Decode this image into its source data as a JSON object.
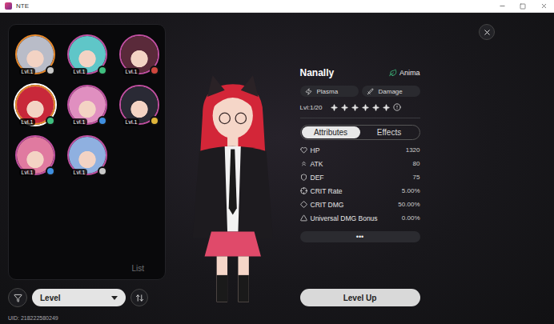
{
  "window": {
    "title": "NTE"
  },
  "characters": [
    {
      "level": "Lvl.1",
      "ring_color": "#e8892b",
      "portrait_color": "#b9bcc8",
      "color": "#c9c9c9",
      "selected": false
    },
    {
      "level": "Lvl.1",
      "ring_color": "#c04fa0",
      "portrait_color": "#5fc6c8",
      "color": "#3fbf7f",
      "selected": false
    },
    {
      "level": "Lvl.1",
      "ring_color": "#c04fa0",
      "portrait_color": "#5a2a3a",
      "color": "#d0473e",
      "selected": false
    },
    {
      "level": "Lvl.1",
      "ring_color": "#e8892b",
      "portrait_color": "#c8283a",
      "color": "#3fbf7f",
      "selected": true
    },
    {
      "level": "Lvl.1",
      "ring_color": "#c04fa0",
      "portrait_color": "#e08fc0",
      "color": "#3f8fe0",
      "selected": false
    },
    {
      "level": "Lvl.1",
      "ring_color": "#c04fa0",
      "portrait_color": "#2a2a35",
      "color": "#e0b53a",
      "selected": false
    },
    {
      "level": "Lvl.1",
      "ring_color": "#c04fa0",
      "portrait_color": "#e07aa0",
      "color": "#3f8fe0",
      "selected": false
    },
    {
      "level": "Lvl.1",
      "ring_color": "#c04fa0",
      "portrait_color": "#8fb0e0",
      "color": "#c9c9c9",
      "selected": false
    }
  ],
  "list_label": "List",
  "sort": {
    "label": "Level"
  },
  "uid": "UID: 218222580249",
  "character": {
    "name": "Nanally",
    "element": "Anima",
    "tags": [
      "Plasma",
      "Damage"
    ],
    "level": "Lvl:1/20",
    "stars": 6
  },
  "tabs": [
    {
      "label": "Attributes",
      "selected": true
    },
    {
      "label": "Effects",
      "selected": false
    }
  ],
  "stats": [
    {
      "label": "HP",
      "value": "1320"
    },
    {
      "label": "ATK",
      "value": "80"
    },
    {
      "label": "DEF",
      "value": "75"
    },
    {
      "label": "CRIT Rate",
      "value": "5.00%"
    },
    {
      "label": "CRIT DMG",
      "value": "50.00%"
    },
    {
      "label": "Universal DMG Bonus",
      "value": "0.00%"
    }
  ],
  "more": "•••",
  "level_up": "Level Up"
}
